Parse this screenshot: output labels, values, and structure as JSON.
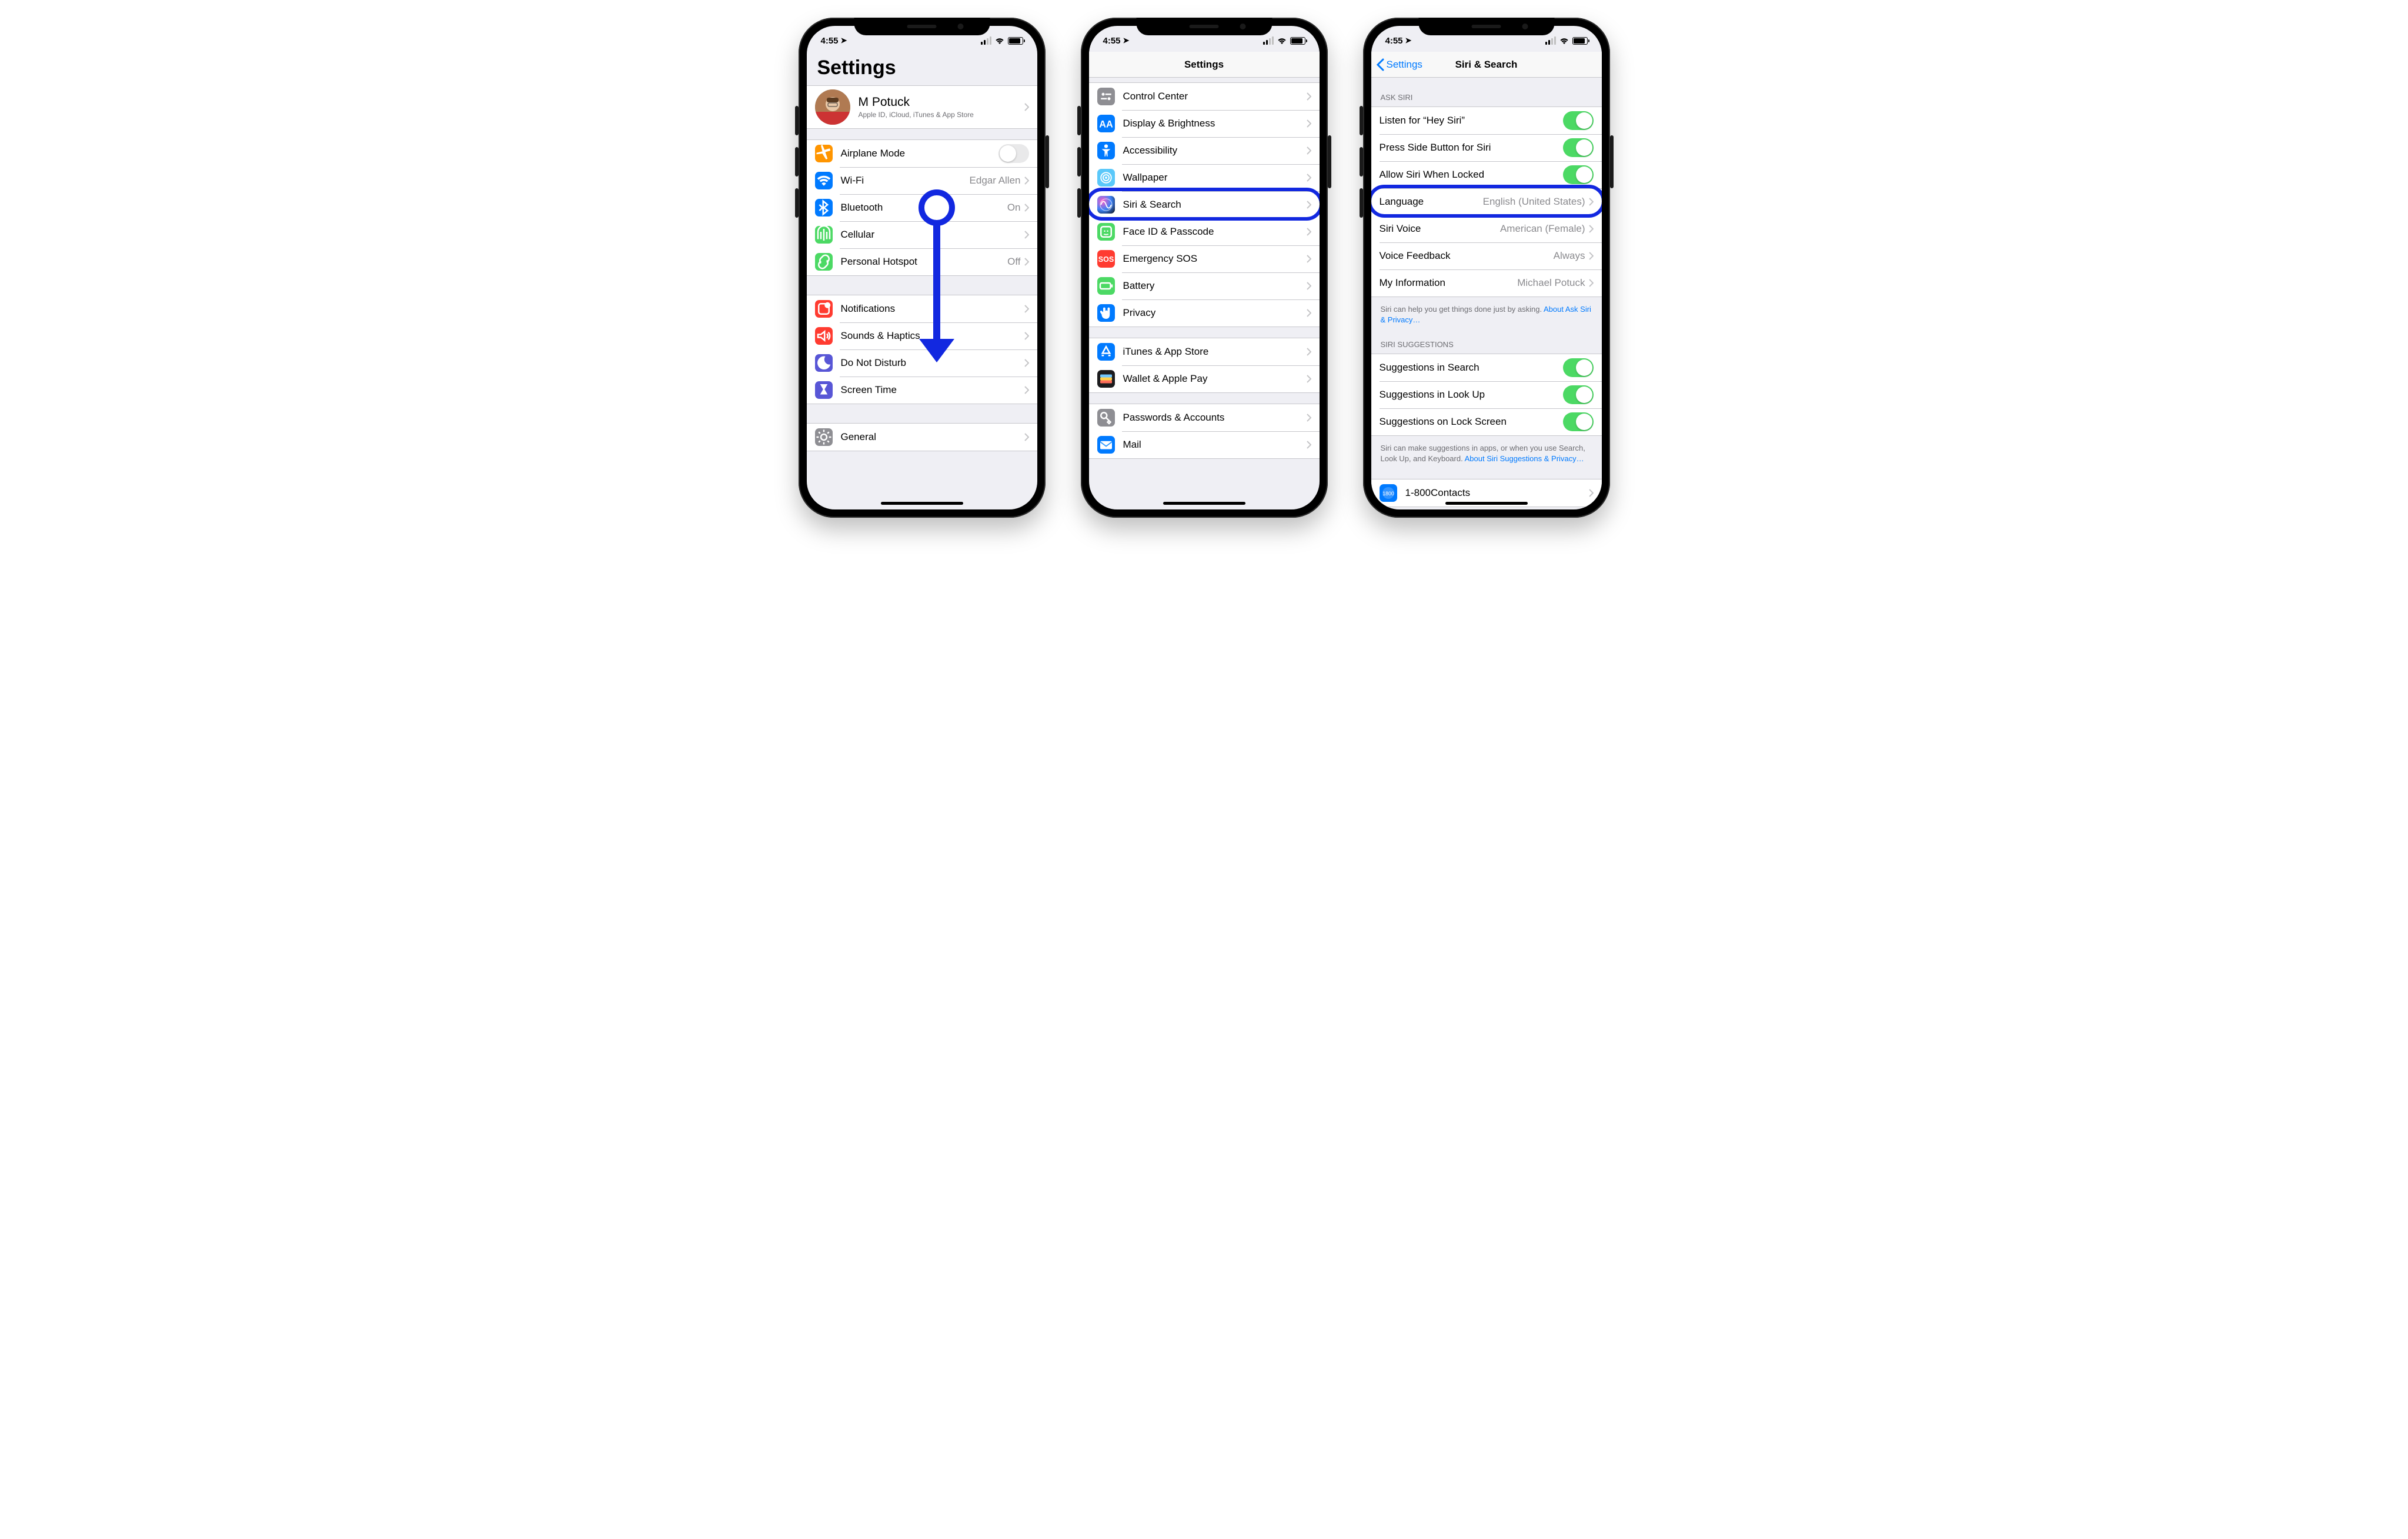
{
  "status": {
    "time": "4:55"
  },
  "phone1": {
    "title": "Settings",
    "profile": {
      "name": "M Potuck",
      "sub": "Apple ID, iCloud, iTunes & App Store"
    },
    "g1": [
      {
        "label": "Airplane Mode",
        "type": "toggle",
        "on": false,
        "ic": "airplane"
      },
      {
        "label": "Wi-Fi",
        "value": "Edgar Allen",
        "ic": "wifi"
      },
      {
        "label": "Bluetooth",
        "value": "On",
        "ic": "bt"
      },
      {
        "label": "Cellular",
        "ic": "cell"
      },
      {
        "label": "Personal Hotspot",
        "value": "Off",
        "ic": "link"
      }
    ],
    "g2": [
      {
        "label": "Notifications",
        "ic": "notif"
      },
      {
        "label": "Sounds & Haptics",
        "ic": "sound"
      },
      {
        "label": "Do Not Disturb",
        "ic": "moon"
      },
      {
        "label": "Screen Time",
        "ic": "hourglass"
      }
    ],
    "g3": [
      {
        "label": "General",
        "ic": "gear"
      }
    ]
  },
  "phone2": {
    "title": "Settings",
    "rowsA": [
      {
        "label": "Control Center",
        "ic": "cc",
        "bg": "bg-gray"
      },
      {
        "label": "Display & Brightness",
        "ic": "AA",
        "bg": "bg-blue"
      },
      {
        "label": "Accessibility",
        "ic": "acc",
        "bg": "bg-blue"
      },
      {
        "label": "Wallpaper",
        "ic": "wall",
        "bg": "bg-teal"
      },
      {
        "label": "Siri & Search",
        "ic": "siri",
        "bg": "bg-grad",
        "hl": true
      },
      {
        "label": "Face ID & Passcode",
        "ic": "face",
        "bg": "bg-green"
      },
      {
        "label": "Emergency SOS",
        "ic": "SOS",
        "bg": "bg-red"
      },
      {
        "label": "Battery",
        "ic": "batt",
        "bg": "bg-green"
      },
      {
        "label": "Privacy",
        "ic": "hand",
        "bg": "bg-blue"
      }
    ],
    "rowsB": [
      {
        "label": "iTunes & App Store",
        "ic": "appst",
        "bg": "bg-blue"
      },
      {
        "label": "Wallet & Apple Pay",
        "ic": "wallet",
        "bg": "bg-dark"
      }
    ],
    "rowsC": [
      {
        "label": "Passwords & Accounts",
        "ic": "key",
        "bg": "bg-gray"
      },
      {
        "label": "Mail",
        "ic": "mail",
        "bg": "bg-blue"
      }
    ]
  },
  "phone3": {
    "back": "Settings",
    "title": "Siri & Search",
    "h1": "Ask Siri",
    "ask": [
      {
        "label": "Listen for “Hey Siri”",
        "toggle": true,
        "on": true
      },
      {
        "label": "Press Side Button for Siri",
        "toggle": true,
        "on": true
      },
      {
        "label": "Allow Siri When Locked",
        "toggle": true,
        "on": true
      },
      {
        "label": "Language",
        "value": "English (United States)",
        "hl": true
      },
      {
        "label": "Siri Voice",
        "value": "American (Female)"
      },
      {
        "label": "Voice Feedback",
        "value": "Always"
      },
      {
        "label": "My Information",
        "value": "Michael Potuck"
      }
    ],
    "f1a": "Siri can help you get things done just by asking. ",
    "f1b": "About Ask Siri & Privacy…",
    "h2": "Siri Suggestions",
    "sugg": [
      {
        "label": "Suggestions in Search",
        "toggle": true,
        "on": true
      },
      {
        "label": "Suggestions in Look Up",
        "toggle": true,
        "on": true
      },
      {
        "label": "Suggestions on Lock Screen",
        "toggle": true,
        "on": true
      }
    ],
    "f2a": "Siri can make suggestions in apps, or when you use Search, Look Up, and Keyboard. ",
    "f2b": "About Siri Suggestions & Privacy…",
    "apps": [
      {
        "label": "1-800Contacts",
        "ic": "1800",
        "bg": "bg-blue"
      }
    ]
  }
}
